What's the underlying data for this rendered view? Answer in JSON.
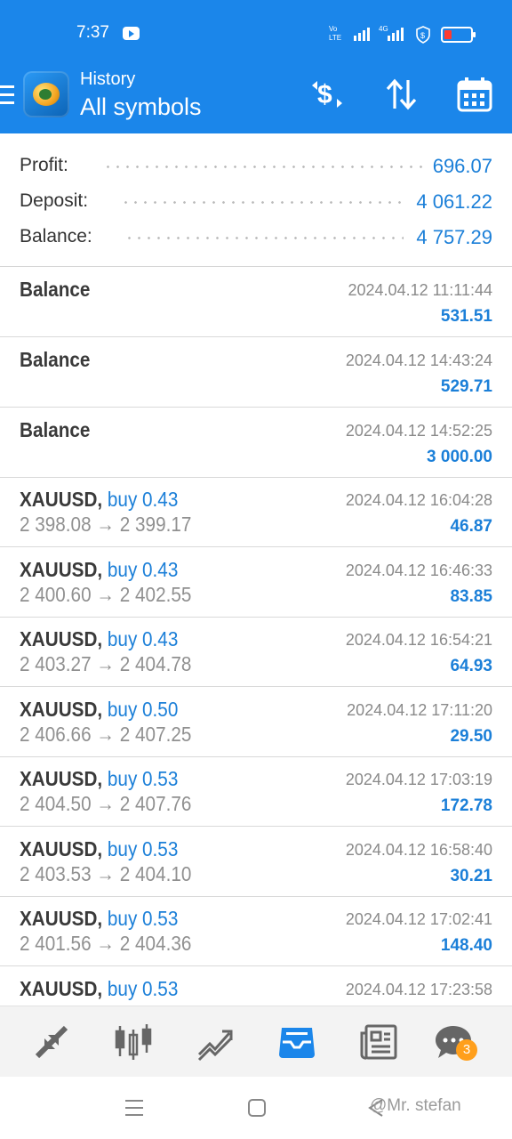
{
  "status_bar": {
    "time": "7:37"
  },
  "header": {
    "subtitle": "History",
    "title": "All symbols"
  },
  "summary": [
    {
      "label": "Profit:",
      "value": "696.07"
    },
    {
      "label": "Deposit:",
      "value": "4 061.22"
    },
    {
      "label": "Balance:",
      "value": "4 757.29"
    }
  ],
  "deals": [
    {
      "title": "Balance",
      "time": "2024.04.12 11:11:44",
      "amount": "531.51"
    },
    {
      "title": "Balance",
      "time": "2024.04.12 14:43:24",
      "amount": "529.71"
    },
    {
      "title": "Balance",
      "time": "2024.04.12 14:52:25",
      "amount": "3 000.00"
    }
  ],
  "trades": [
    {
      "symbol": "XAUUSD,",
      "side": "buy 0.43",
      "prices": "2 398.08 → 2 399.17",
      "time": "2024.04.12 16:04:28",
      "profit": "46.87"
    },
    {
      "symbol": "XAUUSD,",
      "side": "buy 0.43",
      "prices": "2 400.60 → 2 402.55",
      "time": "2024.04.12 16:46:33",
      "profit": "83.85"
    },
    {
      "symbol": "XAUUSD,",
      "side": "buy 0.43",
      "prices": "2 403.27 → 2 404.78",
      "time": "2024.04.12 16:54:21",
      "profit": "64.93"
    },
    {
      "symbol": "XAUUSD,",
      "side": "buy 0.50",
      "prices": "2 406.66 → 2 407.25",
      "time": "2024.04.12 17:11:20",
      "profit": "29.50"
    },
    {
      "symbol": "XAUUSD,",
      "side": "buy 0.53",
      "prices": "2 404.50 → 2 407.76",
      "time": "2024.04.12 17:03:19",
      "profit": "172.78"
    },
    {
      "symbol": "XAUUSD,",
      "side": "buy 0.53",
      "prices": "2 403.53 → 2 404.10",
      "time": "2024.04.12 16:58:40",
      "profit": "30.21"
    },
    {
      "symbol": "XAUUSD,",
      "side": "buy 0.53",
      "prices": "2 401.56 → 2 404.36",
      "time": "2024.04.12 17:02:41",
      "profit": "148.40"
    },
    {
      "symbol": "XAUUSD,",
      "side": "buy 0.53",
      "prices": "",
      "time": "2024.04.12 17:23:58",
      "profit": ""
    }
  ],
  "bottom_nav": {
    "items": [
      "quotes-icon",
      "chart-icon",
      "trade-icon",
      "history-icon",
      "news-icon",
      "messages-icon"
    ],
    "active": "history-icon",
    "badge": "3"
  },
  "watermark": "@Mr. stefan",
  "colors": {
    "header": "#1b86ea",
    "accent": "#1b7fd8",
    "badge": "#ff9f1c"
  }
}
